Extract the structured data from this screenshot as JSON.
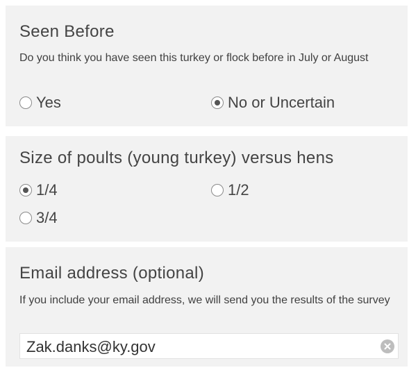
{
  "seen_before": {
    "title": "Seen Before",
    "description": "Do you think you have seen this turkey or flock  before in July or August",
    "options": [
      {
        "label": "Yes",
        "selected": false
      },
      {
        "label": "No or Uncertain",
        "selected": true
      }
    ]
  },
  "poult_size": {
    "title": "Size of poults (young turkey) versus hens",
    "options": [
      {
        "label": "1/4",
        "selected": true
      },
      {
        "label": "1/2",
        "selected": false
      },
      {
        "label": "3/4",
        "selected": false
      }
    ]
  },
  "email": {
    "title": "Email address (optional)",
    "description": "If you include your email address, we will send you the results of the survey",
    "value": "Zak.danks@ky.gov",
    "clear_icon": "clear-circle-x"
  }
}
